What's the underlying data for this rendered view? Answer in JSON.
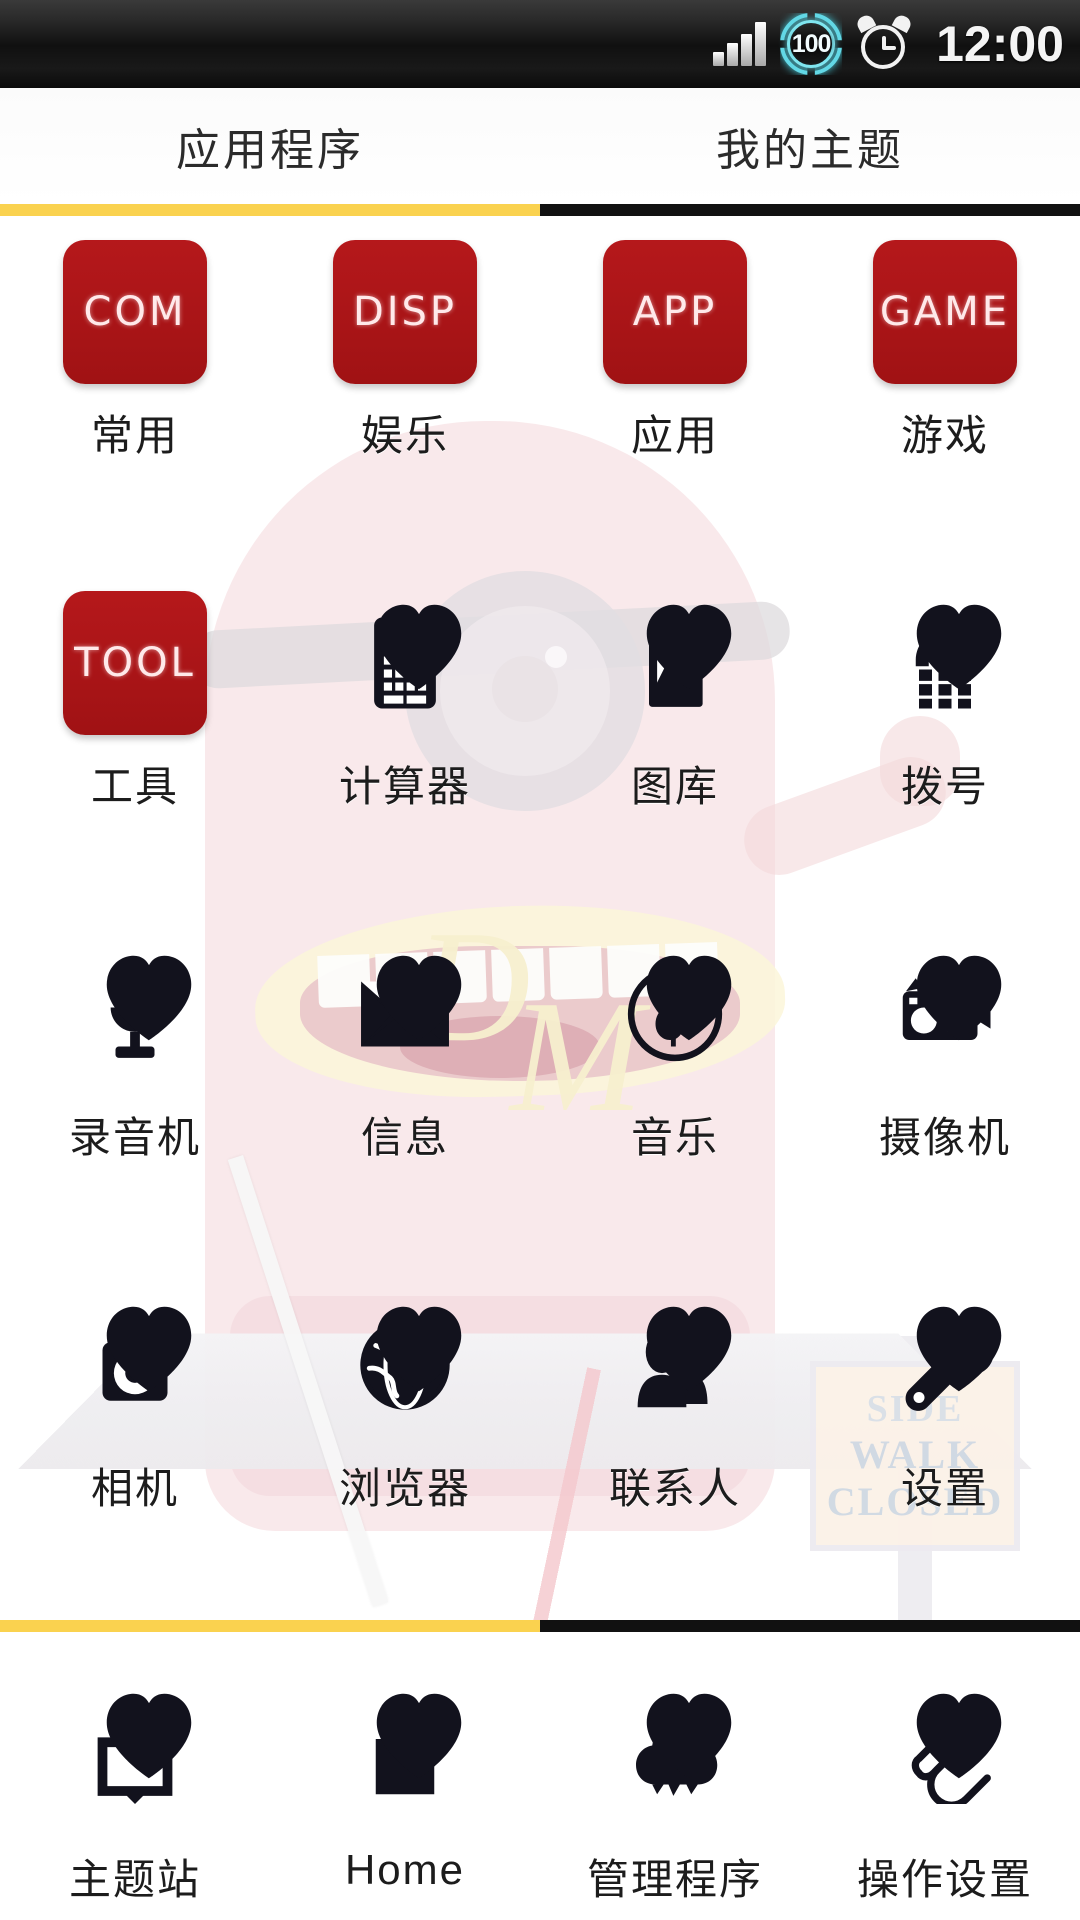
{
  "statusbar": {
    "time": "12:00",
    "battery_percent": "100",
    "icons": [
      "signal-bars-icon",
      "battery-100-icon",
      "alarm-clock-icon"
    ]
  },
  "tabs": {
    "items": [
      {
        "label": "应用程序",
        "active": true
      },
      {
        "label": "我的主题",
        "active": false
      }
    ],
    "active_color": "#fad24f",
    "idle_color": "#111111"
  },
  "background": {
    "watermark_monogram_d": "D",
    "watermark_monogram_m": "M",
    "sign_line1": "SIDE",
    "sign_line2": "WALK",
    "sign_line3": "CLOSED"
  },
  "theme": {
    "tile_red": "#a81417",
    "tile_text": "#ffe9ea",
    "accent_yellow": "#fad24f",
    "icon_black": "#12121d",
    "label_color": "#1c1c1c"
  },
  "grid": {
    "apps": [
      {
        "label": "常用",
        "kind": "tile",
        "tile_text": "COM",
        "icon": "folder-common-tile"
      },
      {
        "label": "娱乐",
        "kind": "tile",
        "tile_text": "DISP",
        "icon": "folder-display-tile"
      },
      {
        "label": "应用",
        "kind": "tile",
        "tile_text": "APP",
        "icon": "folder-app-tile"
      },
      {
        "label": "游戏",
        "kind": "tile",
        "tile_text": "GAME",
        "icon": "folder-game-tile"
      },
      {
        "label": "工具",
        "kind": "tile",
        "tile_text": "TOOL",
        "icon": "folder-tool-tile"
      },
      {
        "label": "计算器",
        "kind": "glyph",
        "icon": "calculator-icon"
      },
      {
        "label": "图库",
        "kind": "glyph",
        "icon": "gallery-picture-icon"
      },
      {
        "label": "拨号",
        "kind": "glyph",
        "icon": "dialpad-phone-icon"
      },
      {
        "label": "录音机",
        "kind": "glyph",
        "icon": "microphone-icon"
      },
      {
        "label": "信息",
        "kind": "glyph",
        "icon": "envelope-message-icon"
      },
      {
        "label": "音乐",
        "kind": "glyph",
        "icon": "music-note-circle-icon"
      },
      {
        "label": "摄像机",
        "kind": "glyph",
        "icon": "camcorder-icon"
      },
      {
        "label": "相机",
        "kind": "glyph",
        "icon": "camera-icon"
      },
      {
        "label": "浏览器",
        "kind": "glyph",
        "icon": "globe-browser-icon"
      },
      {
        "label": "联系人",
        "kind": "glyph",
        "icon": "contacts-people-icon"
      },
      {
        "label": "设置",
        "kind": "glyph",
        "icon": "wrench-settings-icon"
      }
    ]
  },
  "dock": {
    "apps": [
      {
        "label": "主题站",
        "icon": "theme-store-download-icon"
      },
      {
        "label": "Home",
        "icon": "shopping-bag-icon"
      },
      {
        "label": "管理程序",
        "icon": "cloud-manage-icon"
      },
      {
        "label": "操作设置",
        "icon": "paperclip-settings-icon"
      }
    ]
  }
}
